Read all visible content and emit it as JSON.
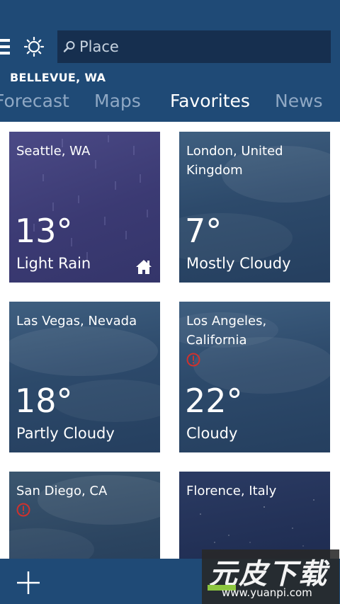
{
  "header": {
    "search_placeholder": "Place",
    "location": "BELLEVUE, WA",
    "tabs": [
      {
        "label": "Forecast",
        "active": false
      },
      {
        "label": "Maps",
        "active": false
      },
      {
        "label": "Favorites",
        "active": true
      },
      {
        "label": "News",
        "active": false
      }
    ]
  },
  "favorites": [
    {
      "name": "Seattle, WA",
      "temp": "13°",
      "condition": "Light Rain",
      "home": true,
      "alert": false,
      "background": "rain"
    },
    {
      "name": "London, United Kingdom",
      "temp": "7°",
      "condition": "Mostly Cloudy",
      "home": false,
      "alert": false,
      "background": "cloud"
    },
    {
      "name": "Las Vegas, Nevada",
      "temp": "18°",
      "condition": "Partly Cloudy",
      "home": false,
      "alert": false,
      "background": "cloud"
    },
    {
      "name": "Los Angeles, California",
      "temp": "22°",
      "condition": "Cloudy",
      "home": false,
      "alert": true,
      "background": "cloud"
    },
    {
      "name": "San Diego, CA",
      "temp": "",
      "condition": "",
      "home": false,
      "alert": true,
      "background": "cloud-dark"
    },
    {
      "name": "Florence, Italy",
      "temp": "",
      "condition": "",
      "home": false,
      "alert": false,
      "background": "night"
    }
  ],
  "bottom_bar": {
    "add_icon": "plus-icon"
  },
  "watermark": {
    "title": "元皮下载",
    "url": "www.yuanpi.com"
  },
  "colors": {
    "header_bg": "#1f4a76",
    "search_bg": "#162f4f",
    "tab_inactive": "#8fa8c4",
    "alert": "#d0312d"
  }
}
